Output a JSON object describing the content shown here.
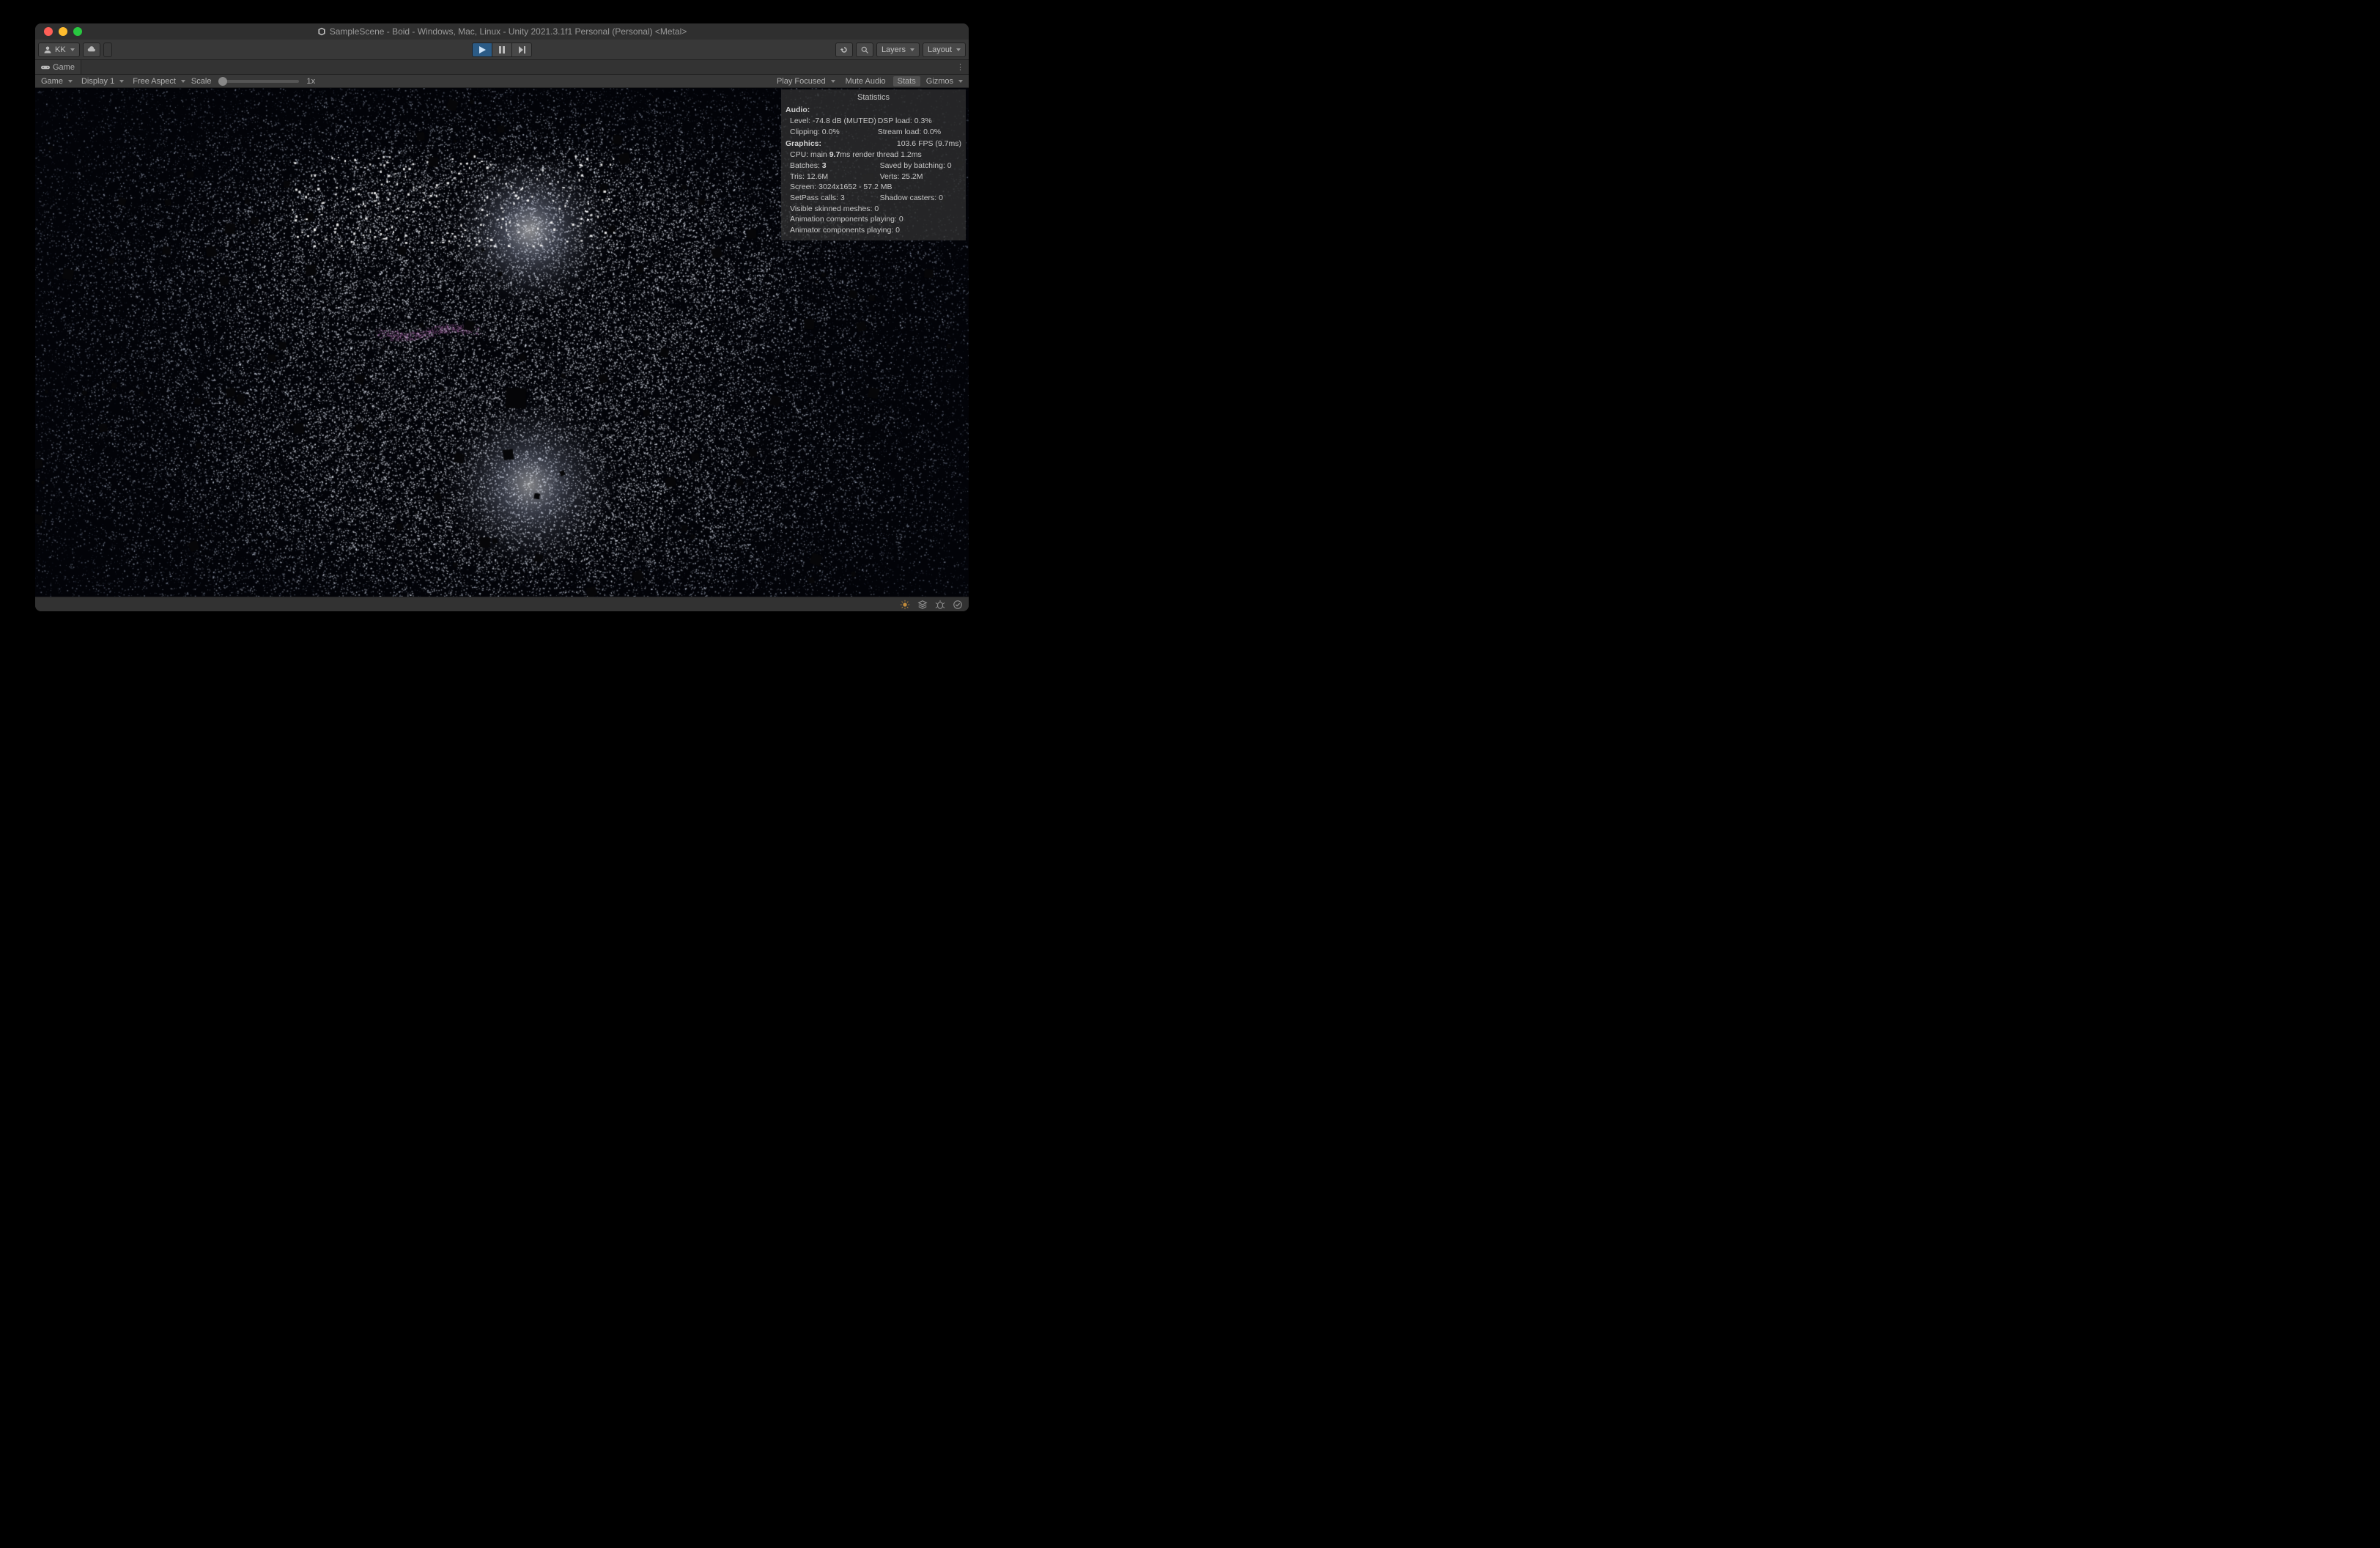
{
  "window": {
    "title": "SampleScene - Boid - Windows, Mac, Linux - Unity 2021.3.1f1 Personal (Personal) <Metal>"
  },
  "toolbar": {
    "account_label": "KK",
    "layers_label": "Layers",
    "layout_label": "Layout"
  },
  "tabs": {
    "game_label": "Game"
  },
  "gameview": {
    "view_dropdown": "Game",
    "display_dropdown": "Display 1",
    "aspect_dropdown": "Free Aspect",
    "scale_label": "Scale",
    "scale_value": "1x",
    "play_focused_label": "Play Focused",
    "mute_label": "Mute Audio",
    "stats_label": "Stats",
    "gizmos_label": "Gizmos"
  },
  "stats": {
    "panel_title": "Statistics",
    "audio_header": "Audio:",
    "audio_level": "Level: -74.8 dB (MUTED)",
    "audio_clipping": "Clipping: 0.0%",
    "audio_dsp": "DSP load: 0.3%",
    "audio_stream": "Stream load: 0.0%",
    "graphics_header": "Graphics:",
    "fps": "103.6 FPS (9.7ms)",
    "cpu_line_pre": "CPU: main ",
    "cpu_main": "9.7",
    "cpu_line_mid": "ms  render thread 1.2ms",
    "batches_pre": "Batches: ",
    "batches_val": "3",
    "saved_batching": "Saved by batching: 0",
    "tris": "Tris: 12.6M",
    "verts": "Verts: 25.2M",
    "screen": "Screen: 3024x1652 - 57.2 MB",
    "setpass": "SetPass calls: 3",
    "shadow": "Shadow casters: 0",
    "skinned": "Visible skinned meshes: 0",
    "anim": "Animation components playing: 0",
    "animator": "Animator components playing: 0"
  }
}
